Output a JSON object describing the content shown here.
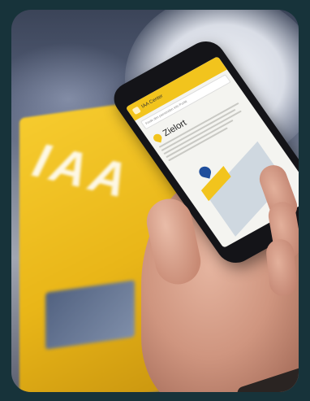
{
  "photo": {
    "box": {
      "label": "IAA",
      "color": "#f2c41d"
    },
    "phone_screen": {
      "app_title": "IAA Center",
      "search_placeholder": "Finde den passenden Info Punkt",
      "heading": "Zielort",
      "accent_color": "#f2c41d",
      "map_marker_color": "#1f4e9c"
    }
  }
}
